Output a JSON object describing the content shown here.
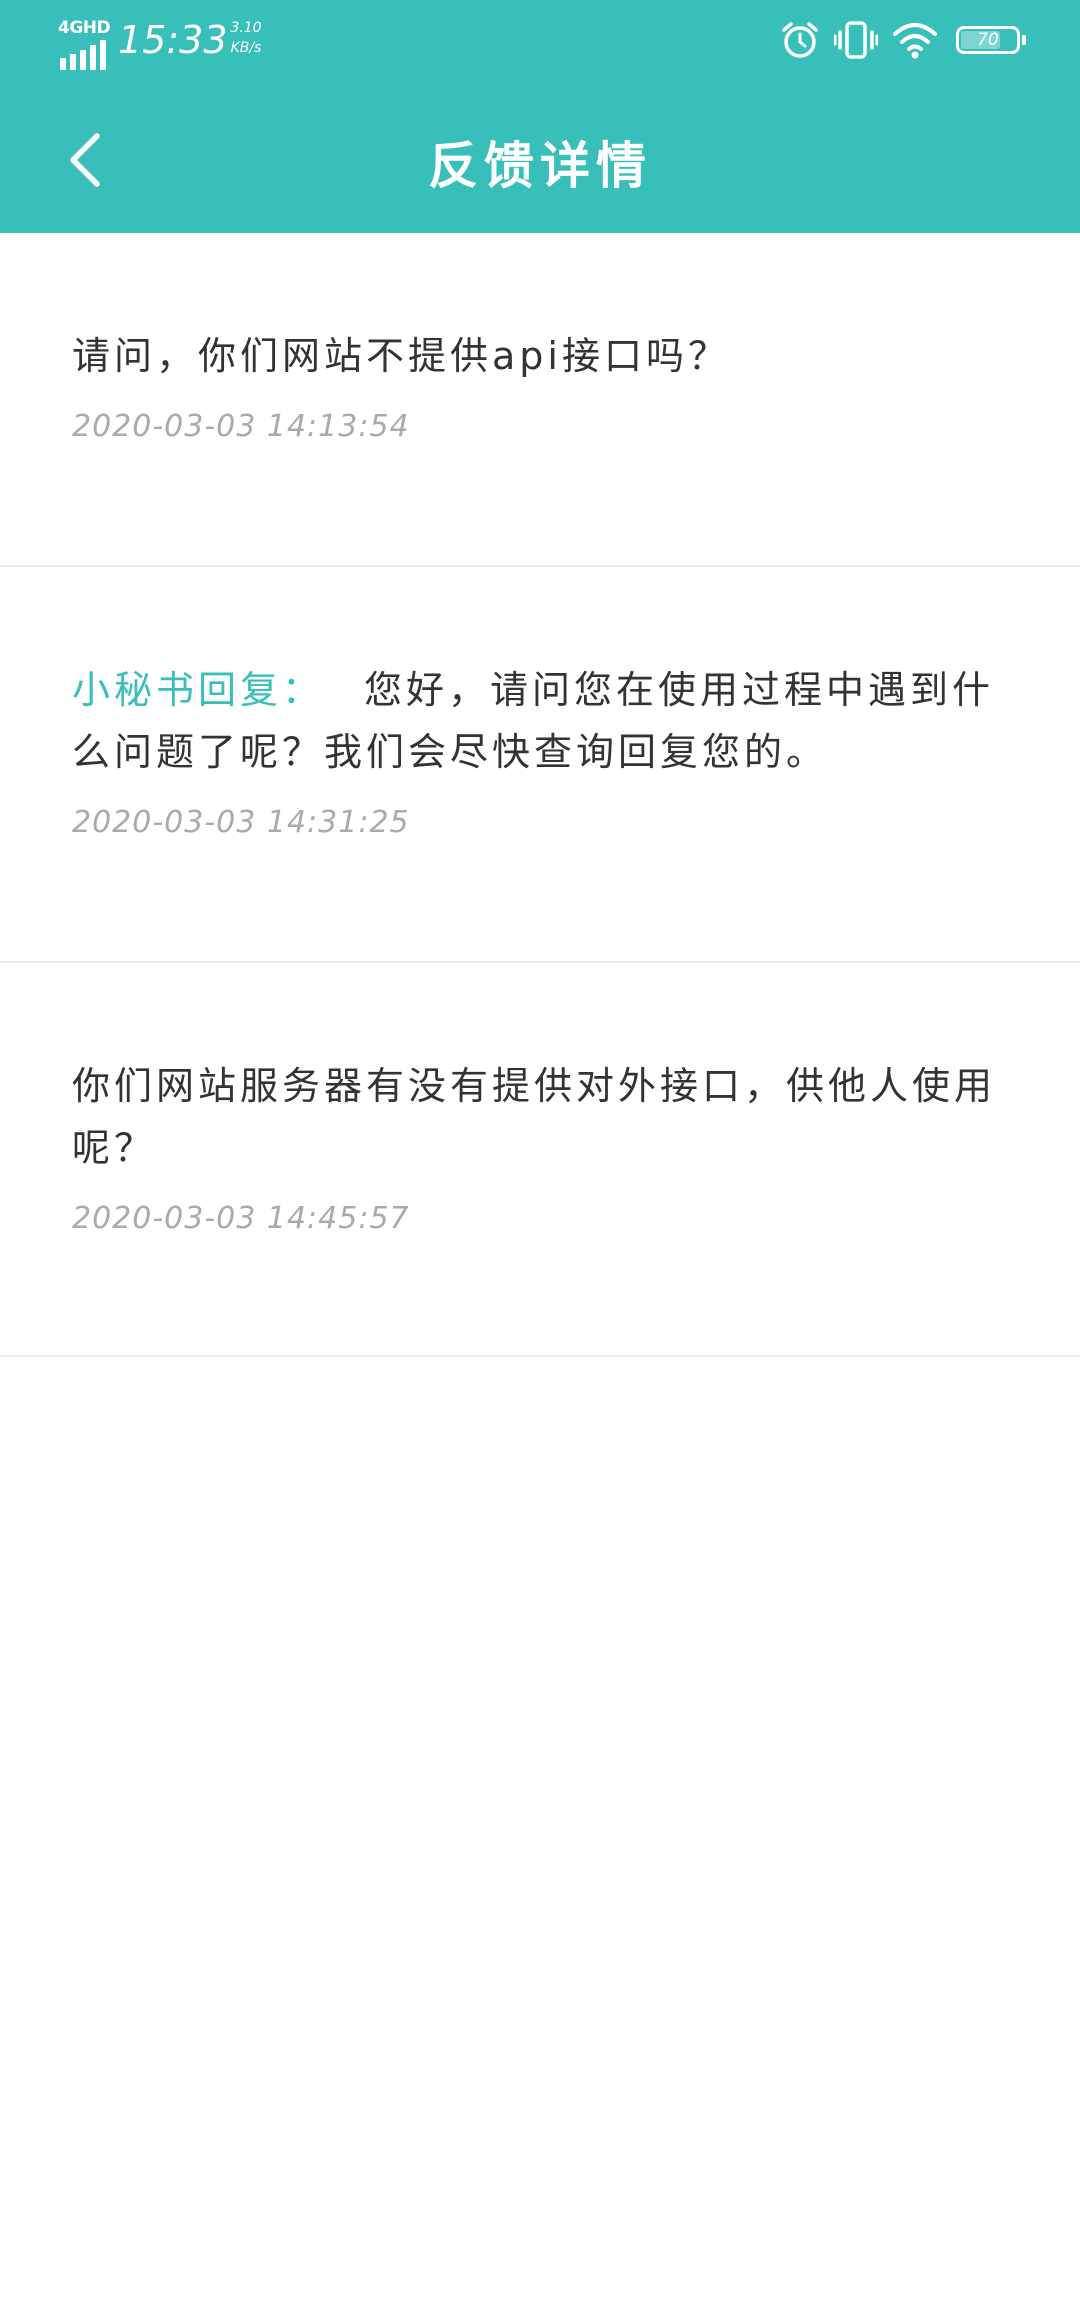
{
  "status_bar": {
    "network": "4GHD",
    "time": "15:33",
    "speed_value": "3.10",
    "speed_unit": "KB/s",
    "battery": "70"
  },
  "header": {
    "title": "反馈详情"
  },
  "feedback": [
    {
      "text": "请问，你们网站不提供api接口吗？",
      "time": "2020-03-03 14:13:54"
    },
    {
      "reply_label": "小秘书回复：",
      "text": "您好，请问您在使用过程中遇到什么问题了呢？我们会尽快查询回复您的。",
      "time": "2020-03-03 14:31:25"
    },
    {
      "text": "你们网站服务器有没有提供对外接口，供他人使用呢？",
      "time": "2020-03-03 14:45:57"
    }
  ],
  "colors": {
    "accent": "#38bfb9",
    "text": "#333333",
    "muted": "#aaaaaa",
    "divider": "#ececec"
  },
  "icons": [
    "back-arrow-icon",
    "signal-icon",
    "alarm-icon",
    "vibrate-icon",
    "wifi-icon",
    "battery-icon"
  ]
}
